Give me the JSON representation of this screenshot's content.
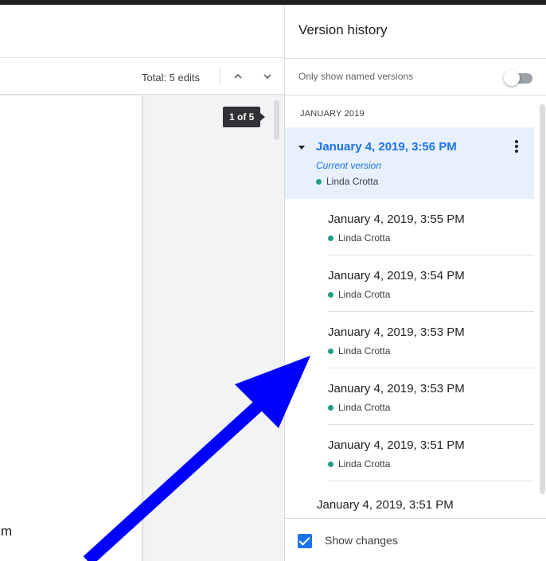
{
  "toolbar": {
    "total_edits": "Total: 5 edits",
    "up_icon": "chevron-up-icon",
    "down_icon": "chevron-down-icon"
  },
  "document": {
    "counter": "1 of 5",
    "visible_text": "m"
  },
  "panel": {
    "title": "Version history",
    "named_only_label": "Only show named versions",
    "named_only_enabled": false,
    "month": "JANUARY 2019",
    "current": {
      "date": "January 4, 2019, 3:56 PM",
      "subtitle": "Current version",
      "user": "Linda Crotta"
    },
    "entries": [
      {
        "date": "January 4, 2019, 3:55 PM",
        "user": "Linda Crotta"
      },
      {
        "date": "January 4, 2019, 3:54 PM",
        "user": "Linda Crotta"
      },
      {
        "date": "January 4, 2019, 3:53 PM",
        "user": "Linda Crotta"
      },
      {
        "date": "January 4, 2019, 3:53 PM",
        "user": "Linda Crotta"
      },
      {
        "date": "January 4, 2019, 3:51 PM",
        "user": "Linda Crotta"
      }
    ],
    "last_entry": "January 4, 2019, 3:51 PM",
    "footer": {
      "show_changes_label": "Show changes",
      "show_changes_checked": true
    }
  },
  "colors": {
    "accent": "#1a73e8",
    "current_bg": "#e8f0fe",
    "user_dot": "#1e9e86",
    "annotation_arrow": "#0000ff"
  }
}
